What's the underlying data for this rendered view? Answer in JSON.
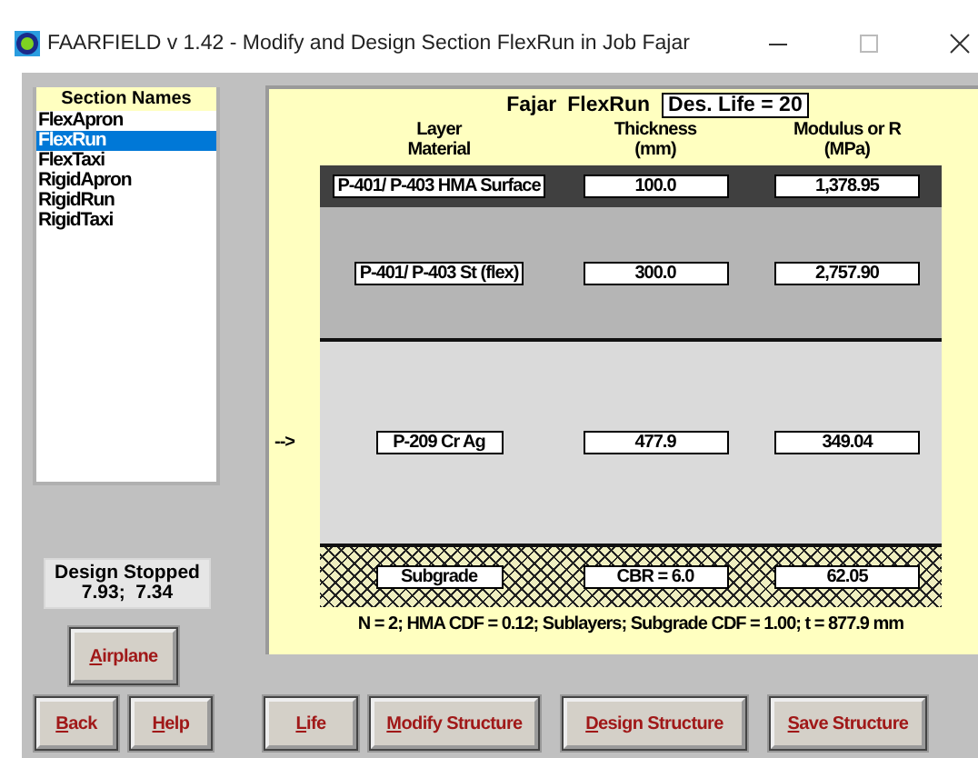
{
  "window": {
    "title": "FAARFIELD v 1.42 - Modify and Design Section FlexRun in Job Fajar"
  },
  "sections": {
    "heading": "Section Names",
    "items": [
      {
        "label": "FlexApron",
        "selected": false
      },
      {
        "label": "FlexRun",
        "selected": true
      },
      {
        "label": "FlexTaxi",
        "selected": false
      },
      {
        "label": "RigidApron",
        "selected": false
      },
      {
        "label": "RigidRun",
        "selected": false
      },
      {
        "label": "RigidTaxi",
        "selected": false
      }
    ]
  },
  "status": {
    "line_1": "Design Stopped",
    "line_2": "7.93;  7.34"
  },
  "structure": {
    "job": "Fajar",
    "section": "FlexRun",
    "design_life": "Des. Life = 20",
    "columns": [
      "Layer\nMaterial",
      "Thickness\n(mm)",
      "Modulus or R\n(MPa)"
    ],
    "layers": [
      {
        "kind": "surface",
        "material": "P-401/ P-403 HMA Surface",
        "thickness": "100.0",
        "modulus": "1,378.95"
      },
      {
        "kind": "base",
        "material": "P-401/ P-403 St (flex)",
        "thickness": "300.0",
        "modulus": "2,757.90"
      },
      {
        "kind": "subbase",
        "material": "P-209 Cr Ag",
        "thickness": "477.9",
        "modulus": "349.04",
        "arrow": "-->"
      },
      {
        "kind": "subgrade",
        "material": "Subgrade",
        "thickness": "CBR = 6.0",
        "modulus": "62.05"
      }
    ],
    "summary": "N = 2; HMA CDF = 0.12; Sublayers; Subgrade CDF = 1.00; t = 877.9 mm"
  },
  "side_buttons": [
    "Airplane"
  ],
  "buttons": [
    "Back",
    "Help",
    "Life",
    "Modify Structure",
    "Design Structure",
    "Save Structure"
  ]
}
